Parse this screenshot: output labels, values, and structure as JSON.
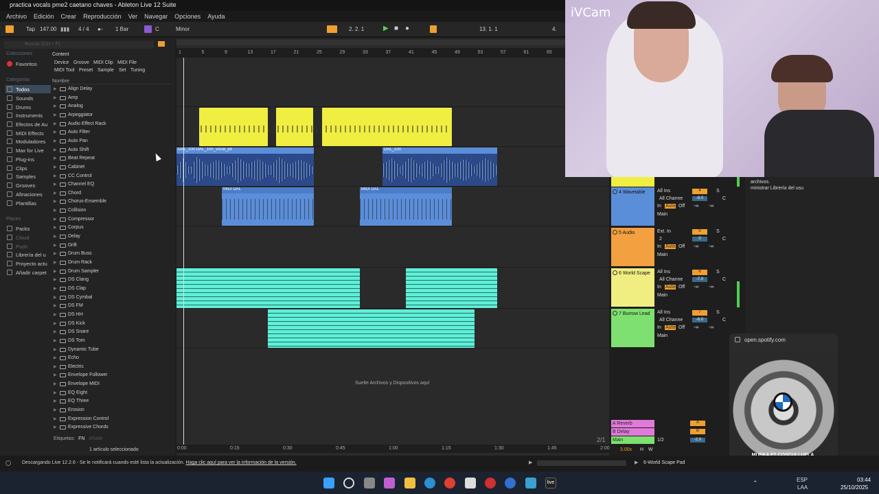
{
  "window": {
    "title": "practica vocals pme2 caetano chaves - Ableton Live 12 Suite"
  },
  "menu": [
    "Archivo",
    "Edición",
    "Crear",
    "Reproducción",
    "Ver",
    "Navegar",
    "Opciones",
    "Ayuda"
  ],
  "transport": {
    "tap": "Tap",
    "tempo": "147.00",
    "signature": "4 / 4",
    "quant": "1 Bar",
    "key": "C",
    "scale": "Minor",
    "position": "2.  2.  1",
    "loop_start": "13.  1.  1",
    "loop_len": "4."
  },
  "browser": {
    "search_placeholder": "Buscar (Ctrl + F)",
    "collections_label": "Colecciones",
    "favorites": "Favoritos",
    "categories_label": "Categorías",
    "categories": [
      "Todos",
      "Sounds",
      "Drums",
      "Instruments",
      "Efectos de Au",
      "MIDI Effects",
      "Moduladores",
      "Max for Live",
      "Plug-ins",
      "Clips",
      "Samples",
      "Grooves",
      "Afinaciones",
      "Plantillas"
    ],
    "places_label": "Places",
    "places": [
      "Packs",
      "Cloud",
      "Push",
      "Librería del u",
      "Proyecto actu",
      "Añadir carpet"
    ],
    "content_label": "Content",
    "tags_row1": [
      "Device",
      "Groove",
      "MIDI Clip",
      "MIDI File"
    ],
    "tags_row2": [
      "MIDI Tool",
      "Preset",
      "Sample",
      "Set",
      "Tuning"
    ],
    "name_header": "Nombre",
    "items": [
      "Align Delay",
      "Amp",
      "Analog",
      "Arpeggiator",
      "Audio Effect Rack",
      "Auto Filter",
      "Auto Pan",
      "Auto Shift",
      "Beat Repeat",
      "Cabinet",
      "CC Control",
      "Channel EQ",
      "Chord",
      "Chorus-Ensemble",
      "Collision",
      "Compressor",
      "Corpus",
      "Delay",
      "Drift",
      "Drum Buss",
      "Drum Rack",
      "Drum Sampler",
      "DS Clang",
      "DS Clap",
      "DS Cymbal",
      "DS FM",
      "DS HH",
      "DS Kick",
      "DS Snare",
      "DS Tom",
      "Dynamic Tube",
      "Echo",
      "Electric",
      "Envelope Follower",
      "Envelope MIDI",
      "EQ Eight",
      "EQ Three",
      "Erosion",
      "Expression Control",
      "Expressive Chords"
    ],
    "labels_text": "Etiquetas:",
    "labels_fn": "FN",
    "labels_add": "Añadir",
    "selected_count": "1 artículo seleccionado"
  },
  "ruler": [
    "1",
    "5",
    "9",
    "13",
    "17",
    "21",
    "25",
    "29",
    "33",
    "37",
    "41",
    "45",
    "49",
    "53",
    "57",
    "61",
    "65"
  ],
  "time_ruler": [
    "0:00",
    "0:15",
    "0:30",
    "0:45",
    "1:00",
    "1:15",
    "1:30",
    "1:45",
    "2:00"
  ],
  "clips": {
    "audio_label": "DAL_100",
    "audio_label2": "DAL_100_vocal_pit",
    "midi_label": "MIDI DAL"
  },
  "drop_hint": "Suelte Archivos y Dispositivos aquí",
  "tracks": [
    {
      "name": "4 Wavetable",
      "color": "#5b8ed8",
      "input": "All Ins",
      "channel": "All Channe",
      "out": "Main",
      "num": "4",
      "vol": "-6.0"
    },
    {
      "name": "5 Audio",
      "color": "#f2a040",
      "input": "Ext. In",
      "channel": "2",
      "out": "Main",
      "num": "5",
      "vol": "0"
    },
    {
      "name": "6 World Scape",
      "color": "#f0ee80",
      "input": "All Ins",
      "channel": "All Channe",
      "out": "Main",
      "num": "6",
      "vol": "-7.0"
    },
    {
      "name": "7 Burrow Lead",
      "color": "#7ee070",
      "input": "All Ins",
      "channel": "All Channe",
      "out": "Main",
      "num": "7",
      "vol": "-6.0"
    }
  ],
  "io_labels": {
    "in": "In",
    "auto": "Auto",
    "off": "Off",
    "inf": "-∞",
    "c": "C",
    "s": "S"
  },
  "returns": [
    {
      "name": "A Reverb",
      "color": "#e07ad8",
      "letter": "A"
    },
    {
      "name": "B Delay",
      "color": "#e07ad8",
      "letter": "B"
    },
    {
      "name": "Main",
      "color": "#7ee070",
      "letter": ""
    }
  ],
  "main_ratio": "1/2",
  "main_vol": "-2.0",
  "overflow_label": "2/1",
  "zoom": "3.00x",
  "zoom_h": "H",
  "zoom_w": "W",
  "webcam_brand": "iVCam",
  "right_panel": {
    "line1": "archivos.",
    "line2": "ministrar Librería del usu"
  },
  "spotify": {
    "url": "open.spotify.com",
    "caption": "MUEKA FT COSCULLUELA"
  },
  "status": {
    "message": "Descargando Live 12.2.6 - Se le notificará cuando esté lista la actualización.",
    "link": "Haga clic aquí para ver la información de la versión.",
    "track": "6-World Scape Pad"
  },
  "tray": {
    "lang": "ESP",
    "region": "LAA",
    "time": "03:44",
    "date": "25/10/2025"
  }
}
